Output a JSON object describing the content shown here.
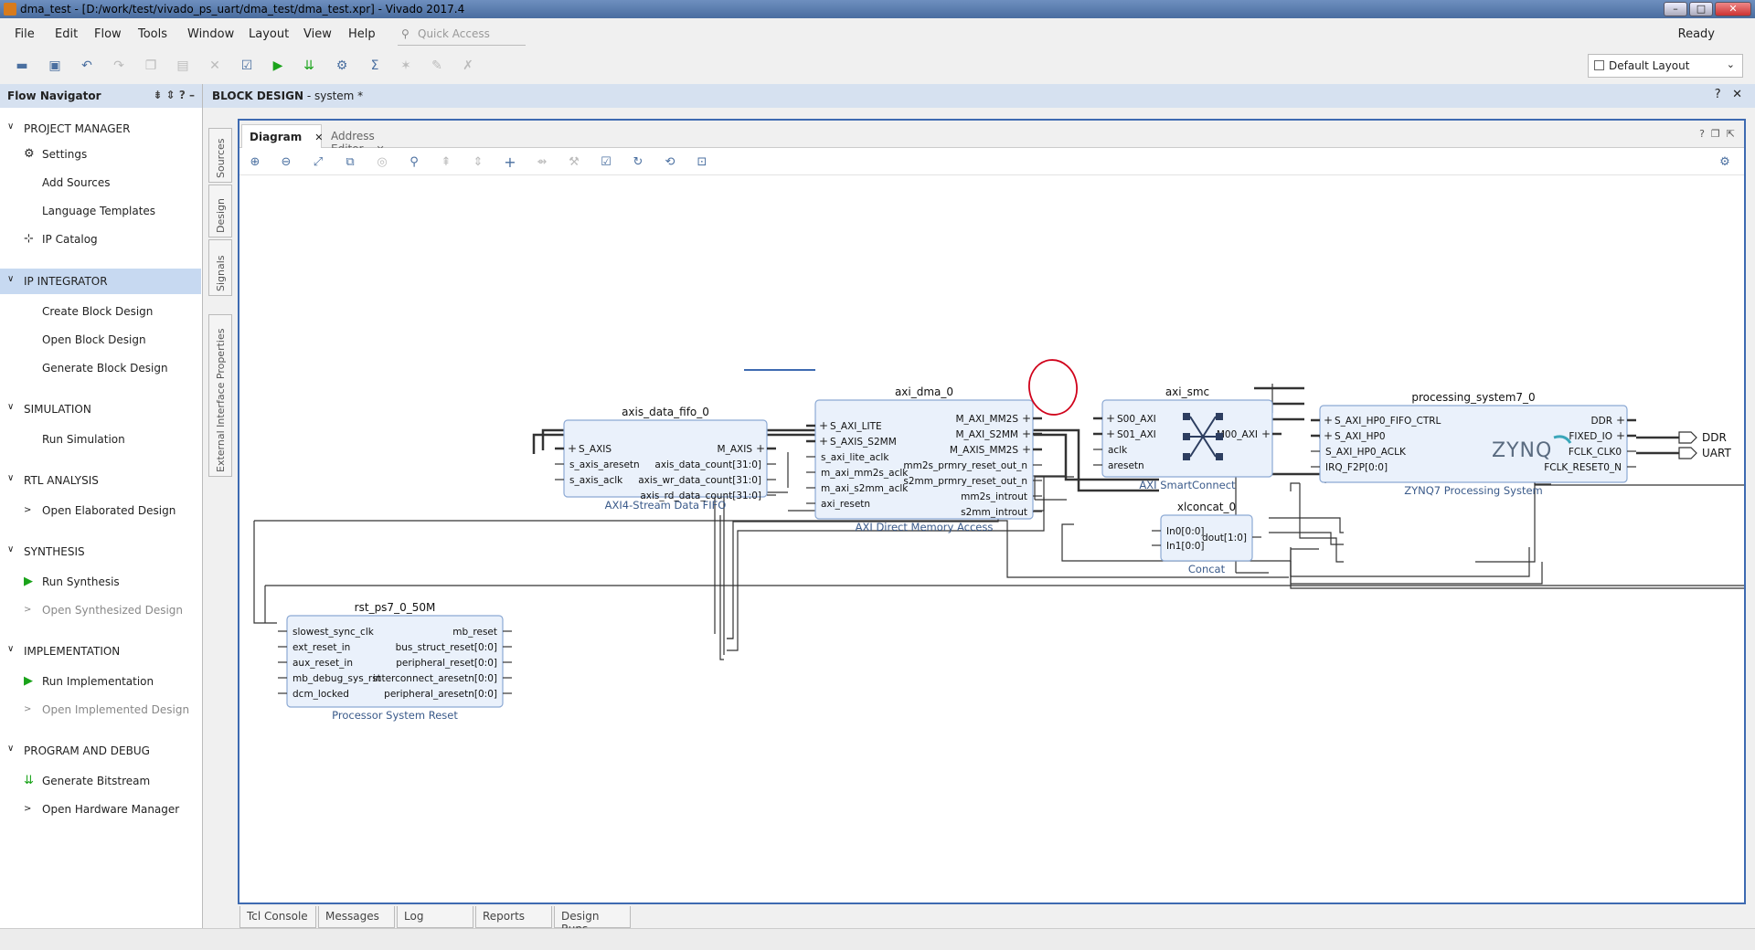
{
  "window": {
    "title": "dma_test - [D:/work/test/vivado_ps_uart/dma_test/dma_test.xpr] - Vivado 2017.4",
    "status": "Ready"
  },
  "menu": [
    "File",
    "Edit",
    "Flow",
    "Tools",
    "Window",
    "Layout",
    "View",
    "Help"
  ],
  "quick_access": {
    "placeholder": "Quick Access"
  },
  "layout_selector": "Default Layout",
  "flow_navigator": {
    "title": "Flow Navigator",
    "sections": [
      {
        "label": "PROJECT MANAGER",
        "items": [
          {
            "label": "Settings",
            "icon": "gear-icon"
          },
          {
            "label": "Add Sources"
          },
          {
            "label": "Language Templates"
          },
          {
            "label": "IP Catalog",
            "icon": "ip-catalog-icon"
          }
        ]
      },
      {
        "label": "IP INTEGRATOR",
        "selected": true,
        "items": [
          {
            "label": "Create Block Design"
          },
          {
            "label": "Open Block Design"
          },
          {
            "label": "Generate Block Design"
          }
        ]
      },
      {
        "label": "SIMULATION",
        "items": [
          {
            "label": "Run Simulation"
          }
        ]
      },
      {
        "label": "RTL ANALYSIS",
        "items": [
          {
            "label": "Open Elaborated Design"
          }
        ]
      },
      {
        "label": "SYNTHESIS",
        "items": [
          {
            "label": "Run Synthesis",
            "icon": "run-icon"
          },
          {
            "label": "Open Synthesized Design",
            "dim": true
          }
        ]
      },
      {
        "label": "IMPLEMENTATION",
        "items": [
          {
            "label": "Run Implementation",
            "icon": "run-icon"
          },
          {
            "label": "Open Implemented Design",
            "dim": true
          }
        ]
      },
      {
        "label": "PROGRAM AND DEBUG",
        "items": [
          {
            "label": "Generate Bitstream",
            "icon": "bitstream-icon"
          },
          {
            "label": "Open Hardware Manager"
          }
        ]
      }
    ]
  },
  "side_tabs": [
    "Sources",
    "Design",
    "Signals",
    "External Interface Properties"
  ],
  "block_design": {
    "title": "BLOCK DESIGN",
    "name": "- system *"
  },
  "tabs": [
    {
      "label": "Diagram",
      "active": true
    },
    {
      "label": "Address Editor"
    }
  ],
  "bottom_tabs": [
    "Tcl Console",
    "Messages",
    "Log",
    "Reports",
    "Design Runs"
  ],
  "blocks": {
    "fifo": {
      "name": "axis_data_fifo_0",
      "subtitle": "AXI4-Stream Data FIFO",
      "ports_left": [
        "S_AXIS",
        "s_axis_aresetn",
        "s_axis_aclk"
      ],
      "ports_right": [
        "M_AXIS",
        "axis_data_count[31:0]",
        "axis_wr_data_count[31:0]",
        "axis_rd_data_count[31:0]"
      ]
    },
    "dma": {
      "name": "axi_dma_0",
      "subtitle": "AXI Direct Memory Access",
      "ports_left": [
        "S_AXI_LITE",
        "S_AXIS_S2MM",
        "s_axi_lite_aclk",
        "m_axi_mm2s_aclk",
        "m_axi_s2mm_aclk",
        "axi_resetn"
      ],
      "ports_right": [
        "M_AXI_MM2S",
        "M_AXI_S2MM",
        "M_AXIS_MM2S",
        "mm2s_prmry_reset_out_n",
        "s2mm_prmry_reset_out_n",
        "mm2s_introut",
        "s2mm_introut"
      ]
    },
    "smc": {
      "name": "axi_smc",
      "subtitle": "AXI SmartConnect",
      "ports_left": [
        "S00_AXI",
        "S01_AXI",
        "aclk",
        "aresetn"
      ],
      "ports_right": [
        "M00_AXI"
      ]
    },
    "ps7": {
      "name": "processing_system7_0",
      "subtitle": "ZYNQ7 Processing System",
      "logo": "ZYNQ",
      "ports_left": [
        "S_AXI_HP0_FIFO_CTRL",
        "S_AXI_HP0",
        "S_AXI_HP0_ACLK",
        "IRQ_F2P[0:0]"
      ],
      "ports_right": [
        "DDR",
        "FIXED_IO",
        "FCLK_CLK0",
        "FCLK_RESET0_N"
      ]
    },
    "concat": {
      "name": "xlconcat_0",
      "subtitle": "Concat",
      "ports_left": [
        "In0[0:0]",
        "In1[0:0]"
      ],
      "ports_right": [
        "dout[1:0]"
      ]
    },
    "rst": {
      "name": "rst_ps7_0_50M",
      "subtitle": "Processor System Reset",
      "ports_left": [
        "slowest_sync_clk",
        "ext_reset_in",
        "aux_reset_in",
        "mb_debug_sys_rst",
        "dcm_locked"
      ],
      "ports_right": [
        "mb_reset",
        "bus_struct_reset[0:0]",
        "peripheral_reset[0:0]",
        "interconnect_aresetn[0:0]",
        "peripheral_aresetn[0:0]"
      ]
    }
  },
  "external_ports": [
    "DDR",
    "UART"
  ],
  "colors": {
    "accent": "#3e6ab1",
    "block_fill": "#eaf1fb",
    "block_border": "#8ca9d4",
    "annotation": "#d0021b"
  }
}
